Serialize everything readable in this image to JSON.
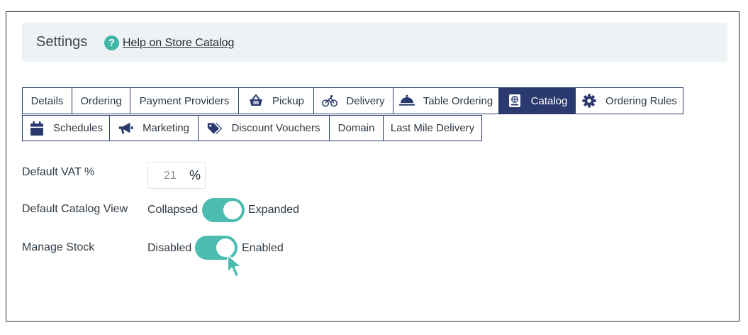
{
  "header": {
    "title": "Settings",
    "help_link": "Help on Store Catalog"
  },
  "tabs_row1": [
    {
      "label": "Details",
      "icon": ""
    },
    {
      "label": "Ordering",
      "icon": ""
    },
    {
      "label": "Payment Providers",
      "icon": ""
    },
    {
      "label": "Pickup",
      "icon": "basket-icon"
    },
    {
      "label": "Delivery",
      "icon": "bicycle-icon"
    },
    {
      "label": "Table Ordering",
      "icon": "cloche-icon"
    },
    {
      "label": "Catalog",
      "icon": "catalog-icon",
      "active": true
    },
    {
      "label": "Ordering Rules",
      "icon": "gear-icon"
    }
  ],
  "tabs_row2": [
    {
      "label": "Schedules",
      "icon": "calendar-icon"
    },
    {
      "label": "Marketing",
      "icon": "megaphone-icon"
    },
    {
      "label": "Discount Vouchers",
      "icon": "tag-icon"
    },
    {
      "label": "Domain",
      "icon": ""
    },
    {
      "label": "Last Mile Delivery",
      "icon": ""
    }
  ],
  "fields": {
    "vat": {
      "label": "Default VAT %",
      "value": "21",
      "unit": "%"
    },
    "catalog_view": {
      "label": "Default Catalog View",
      "off_label": "Collapsed",
      "on_label": "Expanded",
      "state": "on"
    },
    "manage_stock": {
      "label": "Manage Stock",
      "off_label": "Disabled",
      "on_label": "Enabled",
      "state": "on"
    }
  },
  "colors": {
    "accent": "#4bbcaf",
    "tab_active": "#2a3a6e",
    "tab_border": "#2a3f6b",
    "header_bg": "#eef2f4"
  }
}
